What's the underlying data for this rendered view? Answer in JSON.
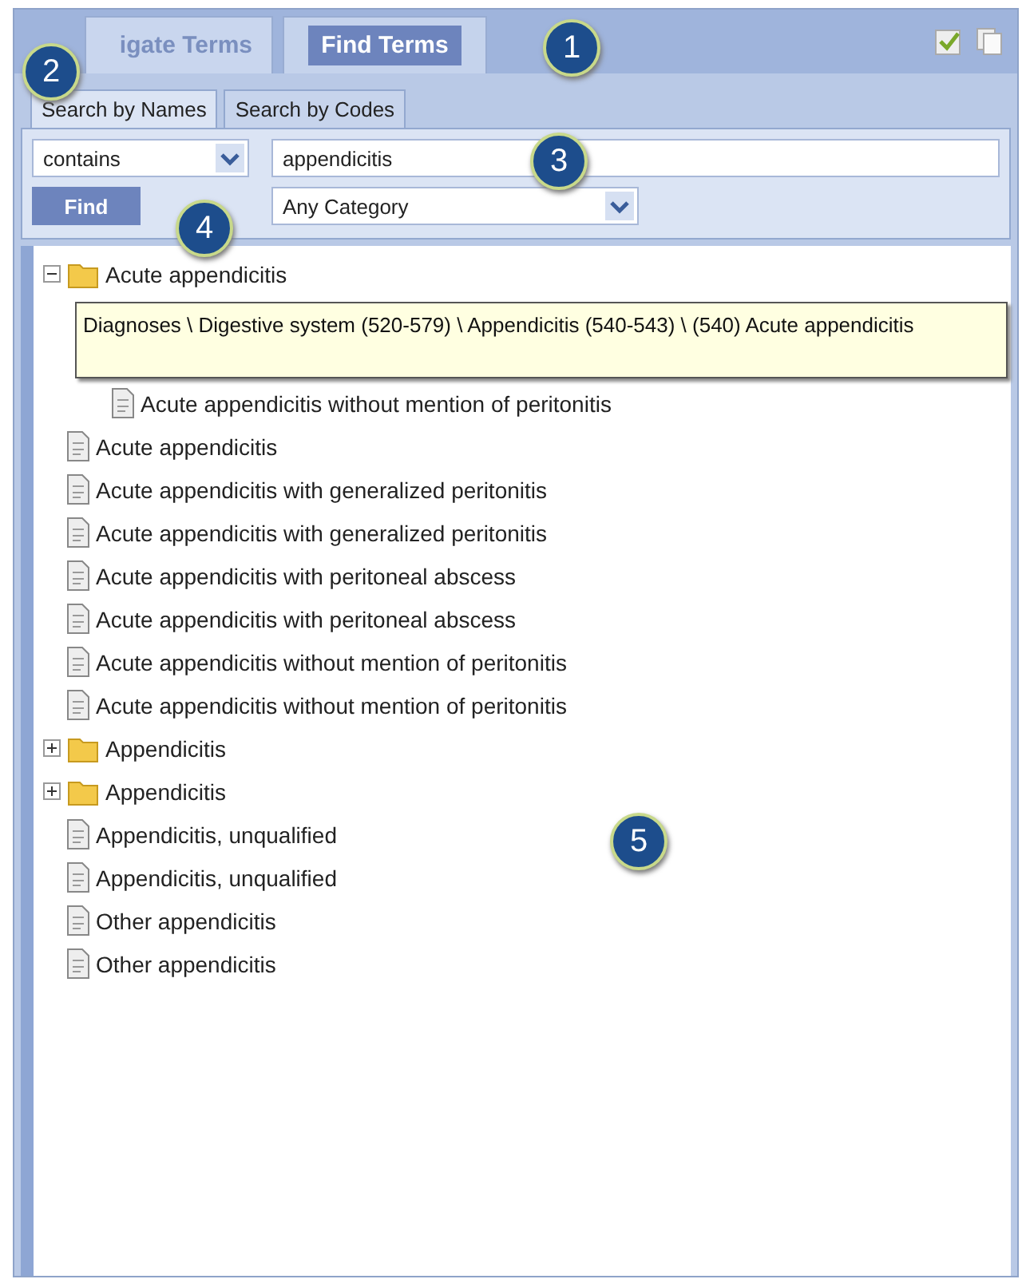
{
  "main_tabs": [
    {
      "label": "igate Terms",
      "selected": false
    },
    {
      "label": "Find Terms",
      "selected": true
    }
  ],
  "sub_tabs": [
    {
      "label": "Search by Names",
      "selected": true
    },
    {
      "label": "Search by Codes",
      "selected": false
    }
  ],
  "match_select": {
    "value": "contains"
  },
  "search_field": {
    "value": "appendicitis"
  },
  "find_button": "Find",
  "category_select": {
    "value": "Any Category"
  },
  "tree": [
    {
      "kind": "folder",
      "label": "Acute appendicitis",
      "expanded": true,
      "children": [
        {
          "kind": "document",
          "label": "Acute appendicitis without mention of peritonitis"
        }
      ]
    },
    {
      "kind": "document",
      "label": "Acute appendicitis"
    },
    {
      "kind": "document",
      "label": "Acute appendicitis with generalized peritonitis"
    },
    {
      "kind": "document",
      "label": "Acute appendicitis with generalized peritonitis"
    },
    {
      "kind": "document",
      "label": "Acute appendicitis with peritoneal abscess"
    },
    {
      "kind": "document",
      "label": "Acute appendicitis with peritoneal abscess"
    },
    {
      "kind": "document",
      "label": "Acute appendicitis without mention of peritonitis"
    },
    {
      "kind": "document",
      "label": "Acute appendicitis without mention of peritonitis"
    },
    {
      "kind": "folder",
      "label": "Appendicitis",
      "expanded": false
    },
    {
      "kind": "folder",
      "label": "Appendicitis",
      "expanded": false
    },
    {
      "kind": "document",
      "label": "Appendicitis, unqualified"
    },
    {
      "kind": "document",
      "label": "Appendicitis, unqualified"
    },
    {
      "kind": "document",
      "label": "Other appendicitis"
    },
    {
      "kind": "document",
      "label": "Other appendicitis"
    }
  ],
  "tooltip": "Diagnoses \\ Digestive system (520-579) \\ Appendicitis (540-543) \\ (540) Acute appendicitis",
  "callouts": [
    "1",
    "2",
    "3",
    "4",
    "5"
  ]
}
